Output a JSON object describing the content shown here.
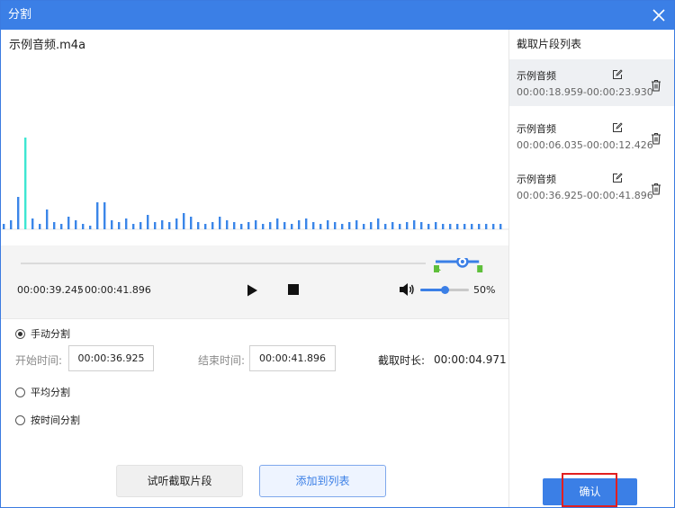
{
  "window": {
    "title": "分割"
  },
  "file": {
    "name": "示例音频.m4a"
  },
  "player": {
    "current_time": "00:00:39.245",
    "separator": "/",
    "total_time": "00:00:41.896",
    "volume_label": "50%",
    "volume_level": 0.5,
    "range_start_fraction": 0.88,
    "range_end_fraction": 0.972,
    "playhead_fraction": 0.937
  },
  "split_modes": [
    {
      "label": "手动分割",
      "selected": true
    },
    {
      "label": "平均分割",
      "selected": false
    },
    {
      "label": "按时间分割",
      "selected": false
    }
  ],
  "manual": {
    "start_label": "开始时间:",
    "start_value": "00:00:36.925",
    "end_label": "结束时间:",
    "end_value": "00:00:41.896",
    "duration_label": "截取时长:",
    "duration_value": "00:00:04.971"
  },
  "actions": {
    "preview_label": "试听截取片段",
    "add_label": "添加到列表"
  },
  "segment_list": {
    "title": "截取片段列表",
    "items": [
      {
        "name": "示例音频",
        "range": "00:00:18.959-00:00:23.930",
        "active": true
      },
      {
        "name": "示例音频",
        "range": "00:00:06.035-00:00:12.426",
        "active": false
      },
      {
        "name": "示例音频",
        "range": "00:00:36.925-00:00:41.896",
        "active": false
      }
    ]
  },
  "confirm_label": "确认",
  "colors": {
    "accent": "#3b7fe6",
    "wave": "#3b86e8",
    "wave_peak": "#3ee6d2",
    "handle_green": "#5fbf3b",
    "highlight": "#e21f1f"
  },
  "icons": {
    "close": "close-icon",
    "play": "play-icon",
    "stop": "stop-icon",
    "volume": "volume-icon",
    "edit": "edit-icon",
    "delete": "trash-icon"
  }
}
